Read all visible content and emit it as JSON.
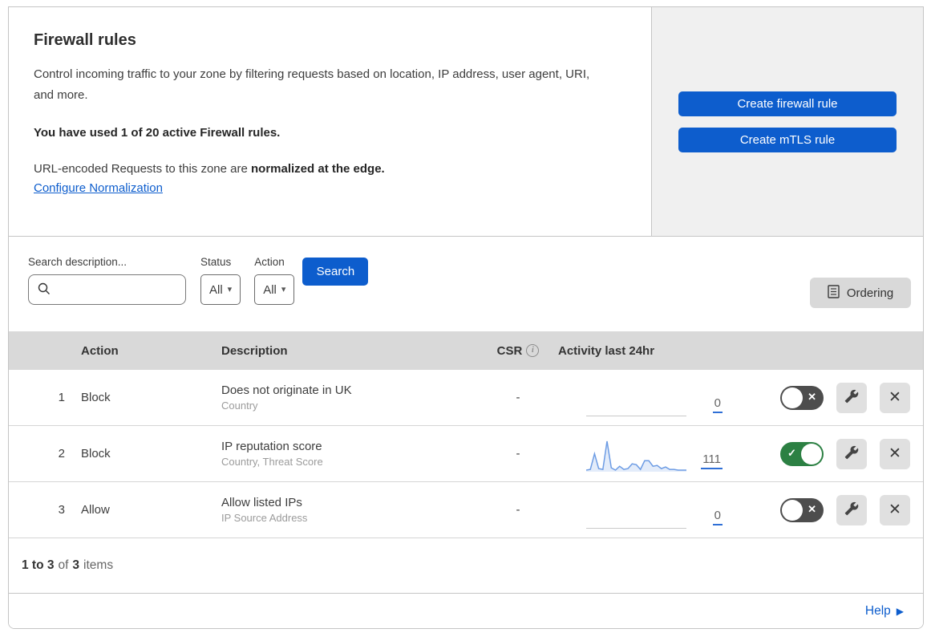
{
  "colors": {
    "accent_blue": "#0d5dcd",
    "toggle_on_green": "#2c8043",
    "toggle_off_gray": "#4d4d4d",
    "sparkline_blue": "#6d9ce4",
    "table_header_gray": "#d9d9d9",
    "side_panel_gray": "#f0f0f0"
  },
  "overview": {
    "title": "Firewall rules",
    "description": "Control incoming traffic to your zone by filtering requests based on location, IP address, user agent, URI, and more.",
    "usage": "You have used 1 of 20 active Firewall rules.",
    "normalization_prefix": "URL-encoded Requests to this zone are ",
    "normalization_bold": "normalized at the edge.",
    "normalization_link": "Configure Normalization",
    "create_firewall_button": "Create firewall rule",
    "create_mtls_button": "Create mTLS rule"
  },
  "filters": {
    "search_label": "Search description...",
    "search_value": "",
    "status_label": "Status",
    "status_value": "All",
    "action_label": "Action",
    "action_value": "All",
    "search_button": "Search",
    "ordering_button": "Ordering"
  },
  "table": {
    "columns": {
      "action": "Action",
      "description": "Description",
      "csr": "CSR",
      "activity": "Activity last 24hr"
    },
    "rows": [
      {
        "priority": "1",
        "action": "Block",
        "description": "Does not originate in UK",
        "criteria": "Country",
        "csr": "-",
        "activity_count": "0",
        "enabled": false
      },
      {
        "priority": "2",
        "action": "Block",
        "description": "IP reputation score",
        "criteria": "Country, Threat Score",
        "csr": "-",
        "activity_count": "111",
        "enabled": true,
        "sparkline": [
          1,
          2,
          22,
          3,
          2,
          38,
          4,
          1,
          6,
          2,
          3,
          9,
          8,
          2,
          13,
          13,
          6,
          7,
          3,
          5,
          2,
          2,
          1,
          1,
          1
        ]
      },
      {
        "priority": "3",
        "action": "Allow",
        "description": "Allow listed IPs",
        "criteria": "IP Source Address",
        "csr": "-",
        "activity_count": "0",
        "enabled": false
      }
    ]
  },
  "pagination": {
    "range": "1 to 3",
    "of": "of",
    "total": "3",
    "items": "items"
  },
  "help": {
    "label": "Help"
  },
  "icons": {
    "caret_down": "▾",
    "check": "✓",
    "cross": "✕",
    "info": "i",
    "arrow_right": "▶"
  }
}
